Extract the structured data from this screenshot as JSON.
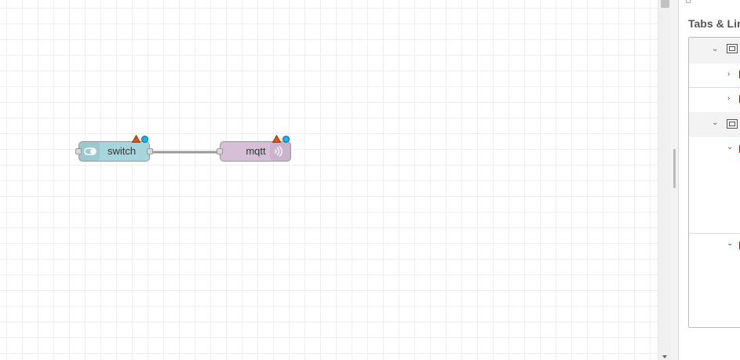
{
  "workspace": {
    "nodes": [
      {
        "id": "switch",
        "label": "switch",
        "icon": "toggle-icon",
        "color": "#a6d5dc"
      },
      {
        "id": "mqtt",
        "label": "mqtt",
        "icon": "radio-waves-icon",
        "color": "#d8bfd8"
      }
    ],
    "wire_color": "#999999",
    "changed_badge_color": "#00bcff",
    "error_badge_color": "#e9510a"
  },
  "sidebar": {
    "title": "Tabs & Lin"
  }
}
